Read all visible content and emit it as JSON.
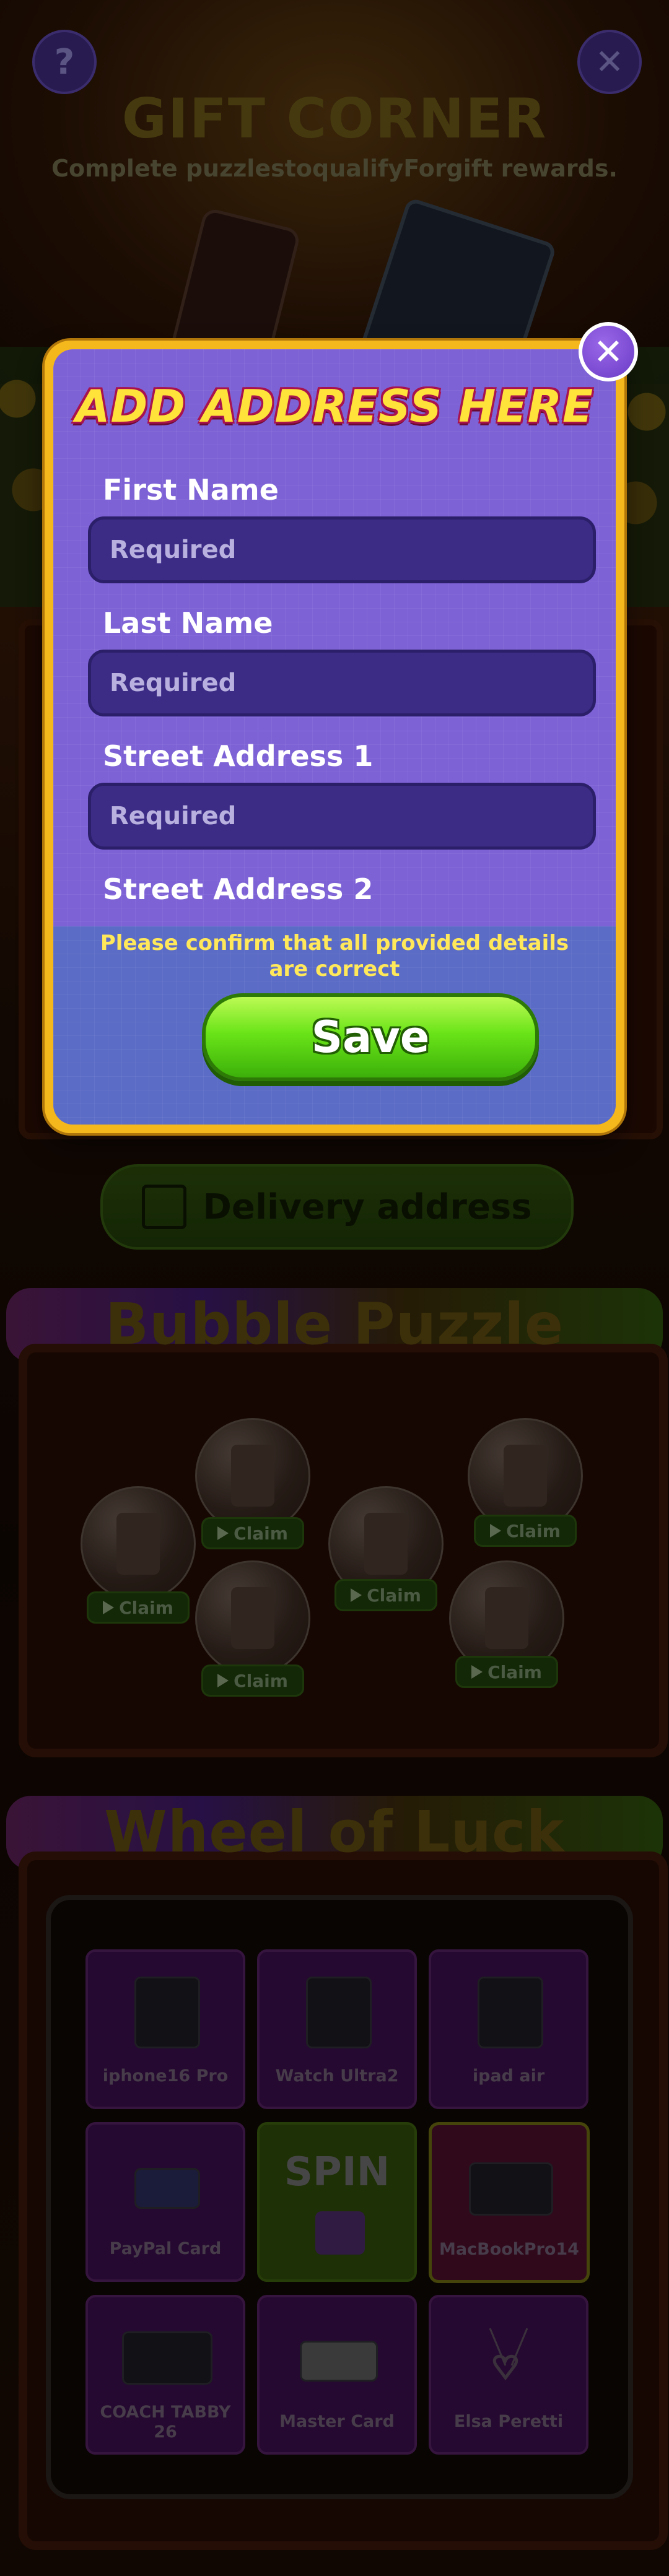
{
  "header": {
    "help_icon": "question-mark-icon",
    "close_icon": "close-icon",
    "title": "GIFT CORNER",
    "subtitle": "Complete puzzlestoqualifyForgift rewards."
  },
  "delivery": {
    "label": "Delivery address",
    "icon": "edit-icon"
  },
  "bubble_puzzle": {
    "title": "Bubble Puzzle",
    "claim_label": "Claim"
  },
  "wheel_of_luck": {
    "title": "Wheel of Luck",
    "spin_label": "SPIN",
    "prizes": [
      "iphone16 Pro",
      "Watch Ultra2",
      "ipad air",
      "PayPal Card",
      "MacBookPro14",
      "COACH TABBY 26",
      "Master Card",
      "Elsa Peretti"
    ]
  },
  "modal": {
    "title": "ADD ADDRESS HERE",
    "fields": [
      {
        "label": "First Name",
        "placeholder": "Required"
      },
      {
        "label": "Last Name",
        "placeholder": "Required"
      },
      {
        "label": "Street Address 1",
        "placeholder": "Required"
      },
      {
        "label": "Street Address 2",
        "placeholder": ""
      }
    ],
    "confirm_text": "Please confirm that all provided details are correct",
    "save_label": "Save",
    "close_symbol": "✕"
  },
  "colors": {
    "modal_border": "#f5b81c",
    "modal_purple": "#7d62d6",
    "save_green": "#6ae418",
    "title_yellow": "#ffe23a"
  }
}
